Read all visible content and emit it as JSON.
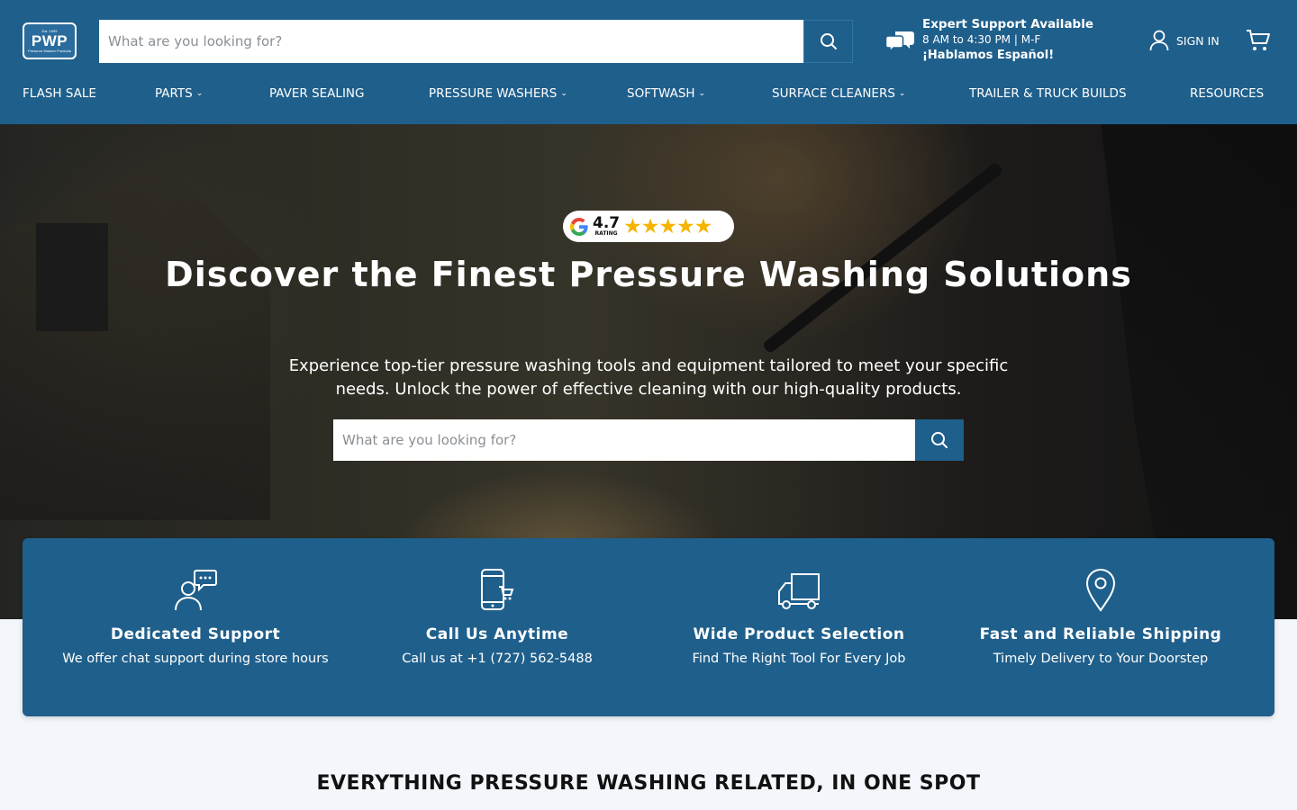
{
  "logo": {
    "text": "PWP",
    "small": "Pressure Washer Products",
    "est": "Est. 1999"
  },
  "top_search": {
    "placeholder": "What are you looking for?"
  },
  "support": {
    "title": "Expert Support Available",
    "hours": "8 AM to 4:30 PM | M-F",
    "spanish": "¡Hablamos Español!"
  },
  "account": {
    "signin_label": "SIGN IN"
  },
  "nav": [
    {
      "label": "FLASH SALE",
      "dropdown": false
    },
    {
      "label": "PARTS",
      "dropdown": true
    },
    {
      "label": "PAVER SEALING",
      "dropdown": false
    },
    {
      "label": "PRESSURE WASHERS",
      "dropdown": true
    },
    {
      "label": "SOFTWASH",
      "dropdown": true
    },
    {
      "label": "SURFACE CLEANERS",
      "dropdown": true
    },
    {
      "label": "TRAILER & TRUCK BUILDS",
      "dropdown": false
    },
    {
      "label": "RESOURCES",
      "dropdown": false
    }
  ],
  "hero": {
    "rating_value": "4.7",
    "rating_label": "RATING",
    "rating_stars": 5,
    "title": "Discover the Finest Pressure Washing Solutions",
    "subtitle": "Experience top-tier pressure washing tools and equipment tailored to meet your specific needs. Unlock the power of effective cleaning with our high-quality products.",
    "search_placeholder": "What are you looking for?"
  },
  "features": [
    {
      "icon": "support-chat-icon",
      "title": "Dedicated Support",
      "desc": "We offer chat support during store hours"
    },
    {
      "icon": "phone-cart-icon",
      "title": "Call Us Anytime",
      "desc": "Call us at +1 (727) 562-5488"
    },
    {
      "icon": "delivery-truck-icon",
      "title": "Wide Product Selection",
      "desc": "Find The Right Tool For Every Job"
    },
    {
      "icon": "map-pin-icon",
      "title": "Fast and Reliable Shipping",
      "desc": "Timely Delivery to Your Doorstep"
    }
  ],
  "section": {
    "title": "EVERYTHING PRESSURE WASHING RELATED, IN ONE SPOT"
  },
  "colors": {
    "brand": "#1f5f8b",
    "star": "#f4b400",
    "page_bg": "#f3f6fa"
  }
}
